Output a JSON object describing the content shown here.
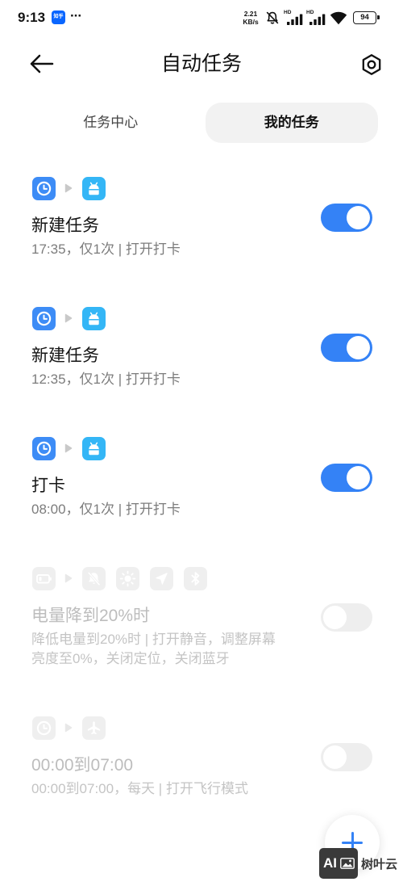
{
  "status_bar": {
    "time": "9:13",
    "notification_app": "知乎",
    "more_notifications": "···",
    "net_speed_value": "2.21",
    "net_speed_unit": "KB/s",
    "sim1_label": "HD",
    "sim2_label": "HD",
    "battery_level": "94",
    "status_icons": [
      "mute-icon",
      "signal-icon",
      "signal-icon",
      "wifi-icon",
      "battery-icon"
    ]
  },
  "header": {
    "title": "自动任务",
    "back_icon": "back-arrow-icon",
    "settings_icon": "settings-icon"
  },
  "tabs": [
    {
      "label": "任务中心",
      "selected": false
    },
    {
      "label": "我的任务",
      "selected": true
    }
  ],
  "tasks": [
    {
      "triggers": [
        "clock-icon"
      ],
      "actions": [
        "app-icon"
      ],
      "title": "新建任务",
      "desc_lines": [
        "17:35，仅1次 | 打开打卡"
      ],
      "enabled": true
    },
    {
      "triggers": [
        "clock-icon"
      ],
      "actions": [
        "app-icon"
      ],
      "title": "新建任务",
      "desc_lines": [
        "12:35，仅1次 | 打开打卡"
      ],
      "enabled": true
    },
    {
      "triggers": [
        "clock-icon"
      ],
      "actions": [
        "app-icon"
      ],
      "title": "打卡",
      "desc_lines": [
        "08:00，仅1次 | 打开打卡"
      ],
      "enabled": true
    },
    {
      "triggers": [
        "battery-icon"
      ],
      "actions": [
        "mute-icon",
        "brightness-icon",
        "location-icon",
        "bluetooth-icon"
      ],
      "title": "电量降到20%时",
      "desc_lines": [
        "降低电量到20%时 | 打开静音，调整屏幕",
        "亮度至0%，关闭定位，关闭蓝牙"
      ],
      "enabled": false
    },
    {
      "triggers": [
        "clock-icon"
      ],
      "actions": [
        "airplane-icon"
      ],
      "title": "00:00到07:00",
      "desc_lines": [
        "00:00到07:00，每天 | 打开飞行模式"
      ],
      "enabled": false
    }
  ],
  "fab": {
    "icon": "plus-icon"
  },
  "watermark": {
    "logo_text": "AI",
    "text": "树叶云"
  },
  "colors": {
    "accent": "#3482F6",
    "toggle_off": "#EEEEEE",
    "zhihu_blue": "#0A66FF",
    "disabled_icon_bg": "#EFEFEF",
    "flow_arrow": "#C9C9C9",
    "flow_arrow_disabled": "#E8E8E8",
    "icon_bg": {
      "clock-icon": "#3D8CF6",
      "app-icon": "#34B6F6"
    }
  }
}
